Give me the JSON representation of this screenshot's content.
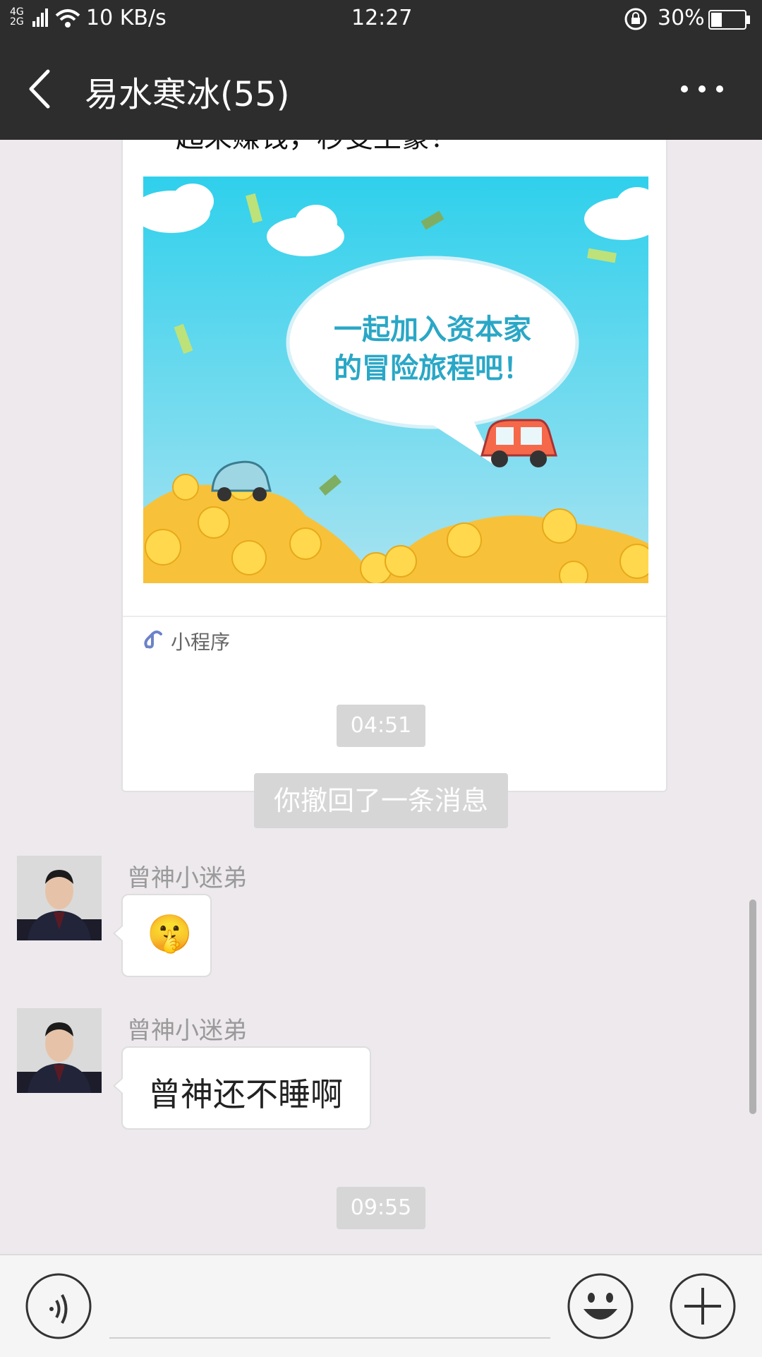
{
  "status_bar": {
    "network_type": "4G 2G",
    "speed": "10 KB/s",
    "time": "12:27",
    "battery": "30%"
  },
  "header": {
    "title": "易水寒冰(55)"
  },
  "shared_card": {
    "title_partial": "起来赚钱，秒变土豪！",
    "image_text_line1": "一起加入资本家",
    "image_text_line2": "的冒险旅程吧！",
    "footer_label": "小程序"
  },
  "messages": [
    {
      "type": "timestamp",
      "text": "04:51"
    },
    {
      "type": "system",
      "text": "你撤回了一条消息"
    },
    {
      "type": "incoming",
      "sender": "曾神小迷弟",
      "content": "emoji",
      "emoji": "🤫"
    },
    {
      "type": "incoming",
      "sender": "曾神小迷弟",
      "content": "text",
      "text": "曾神还不睡啊"
    },
    {
      "type": "timestamp",
      "text": "09:55"
    }
  ],
  "input_bar": {
    "voice_icon": "voice-icon",
    "emoji_icon": "emoji-icon",
    "plus_icon": "plus-icon",
    "text_value": ""
  },
  "colors": {
    "header_bg": "#2d2d2d",
    "chat_bg": "#ede9ed",
    "bubble_bg": "#ffffff",
    "badge_bg": "#d6d6d6"
  }
}
